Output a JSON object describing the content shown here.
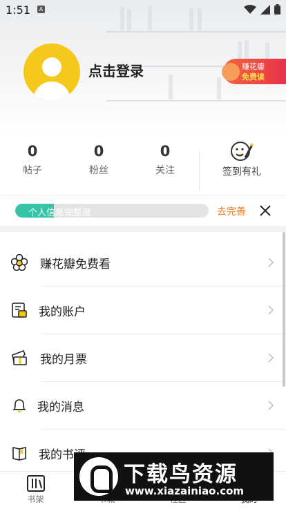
{
  "status_bar": {
    "time": "1:51",
    "app_glyph": "A"
  },
  "profile": {
    "login_text": "点击登录"
  },
  "earn_badge": {
    "line1": "赚花瓣",
    "line2": "免费读"
  },
  "stats": [
    {
      "value": "0",
      "label": "帖子"
    },
    {
      "value": "0",
      "label": "粉丝"
    },
    {
      "value": "0",
      "label": "关注"
    }
  ],
  "sign_in": {
    "label": "签到有礼"
  },
  "profile_completion": {
    "label": "个人信息完整度",
    "progress_fraction": 0.2,
    "action_label": "去完善"
  },
  "menu": [
    {
      "label": "赚花瓣免费看",
      "icon": "flower-icon"
    },
    {
      "label": "我的账户",
      "icon": "wallet-icon"
    },
    {
      "label": "我的月票",
      "icon": "ticket-icon"
    },
    {
      "label": "我的消息",
      "icon": "bell-icon"
    },
    {
      "label": "我的书评",
      "icon": "review-icon"
    }
  ],
  "tabs": [
    {
      "label": "书架",
      "icon": "bookshelf-icon"
    },
    {
      "label": "书城",
      "icon": "store-icon"
    },
    {
      "label": "社区",
      "icon": "community-icon"
    },
    {
      "label": "我的",
      "icon": "profile-icon"
    }
  ],
  "watermark": {
    "title": "下载鸟资源",
    "url": "www.xiazainiao.com"
  },
  "colors": {
    "accent_teal": "#37c3a6",
    "accent_orange": "#f07b22",
    "avatar_yellow": "#f6c81b",
    "badge_red": "#e8324c"
  }
}
